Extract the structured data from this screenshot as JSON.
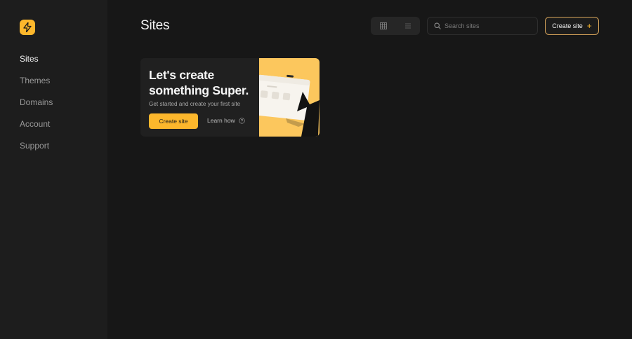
{
  "sidebar": {
    "items": [
      {
        "label": "Sites",
        "active": true
      },
      {
        "label": "Themes",
        "active": false
      },
      {
        "label": "Domains",
        "active": false
      },
      {
        "label": "Account",
        "active": false
      },
      {
        "label": "Support",
        "active": false
      }
    ]
  },
  "header": {
    "title": "Sites",
    "search_placeholder": "Search sites",
    "create_label": "Create site"
  },
  "promo": {
    "heading": "Let's create something Super.",
    "subtitle": "Get started and create your first site",
    "create_label": "Create site",
    "learn_label": "Learn how"
  },
  "colors": {
    "accent": "#fcb72c",
    "background": "#171717",
    "sidebar": "#1d1d1d",
    "card": "#202020"
  },
  "icons": {
    "logo": "lightning-bolt-icon",
    "grid_view": "grid-icon",
    "list_view": "list-icon",
    "search": "search-icon",
    "create": "plus-icon",
    "learn": "help-circle-icon"
  }
}
